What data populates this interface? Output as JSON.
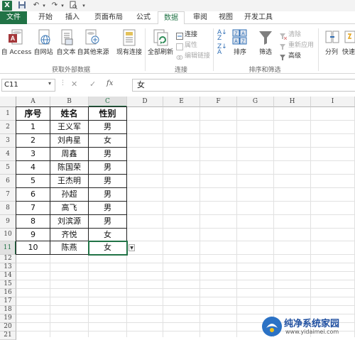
{
  "quick_access": {
    "app_icon": "X"
  },
  "tabs": [
    "文件",
    "开始",
    "插入",
    "页面布局",
    "公式",
    "数据",
    "审阅",
    "视图",
    "开发工具"
  ],
  "ribbon": {
    "get_external": {
      "buttons": [
        "自 Access",
        "自网站",
        "自文本",
        "自其他来源",
        "现有连接"
      ],
      "label": "获取外部数据"
    },
    "connections": {
      "refresh_all": "全部刷新",
      "items": [
        "连接",
        "属性",
        "编辑链接"
      ],
      "label": "连接"
    },
    "sort_filter": {
      "sort": "排序",
      "filter": "筛选",
      "items": [
        "清除",
        "重新应用",
        "高级"
      ],
      "label": "排序和筛选"
    },
    "data_tools": {
      "split": "分列",
      "quick": "快速"
    }
  },
  "formula_bar": {
    "name_box": "C11",
    "fx": "fx",
    "value": "女"
  },
  "grid": {
    "columns": [
      "A",
      "B",
      "C",
      "D",
      "E",
      "F",
      "G",
      "H",
      "I"
    ],
    "rows": [
      "1",
      "2",
      "3",
      "4",
      "5",
      "6",
      "7",
      "8",
      "9",
      "10",
      "11",
      "12",
      "13",
      "14",
      "15",
      "16",
      "17",
      "18",
      "19",
      "20",
      "21",
      "22",
      "23"
    ],
    "table": {
      "headers": [
        "序号",
        "姓名",
        "性别"
      ],
      "rows": [
        [
          "1",
          "王义军",
          "男"
        ],
        [
          "2",
          "刘冉星",
          "女"
        ],
        [
          "3",
          "周鑫",
          "男"
        ],
        [
          "4",
          "陈国荣",
          "男"
        ],
        [
          "5",
          "王杰明",
          "男"
        ],
        [
          "6",
          "孙超",
          "男"
        ],
        [
          "7",
          "高飞",
          "男"
        ],
        [
          "8",
          "刘滨源",
          "男"
        ],
        [
          "9",
          "齐悦",
          "女"
        ],
        [
          "10",
          "陈燕",
          "女"
        ]
      ]
    }
  },
  "watermark": {
    "title": "纯净系统家园",
    "url": "www.yidaimei.com"
  }
}
